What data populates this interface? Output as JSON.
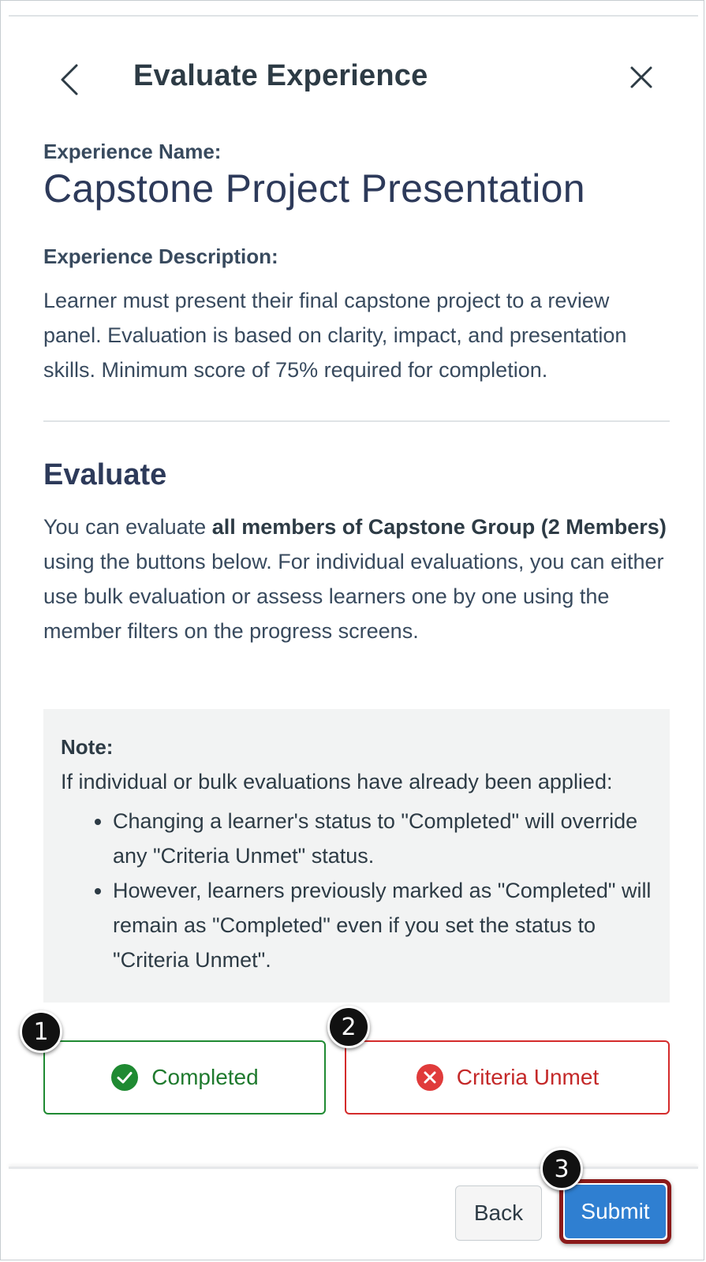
{
  "header": {
    "title": "Evaluate Experience",
    "back_icon": "chevron-left-icon",
    "close_icon": "close-icon"
  },
  "experience": {
    "name_label": "Experience Name:",
    "name": "Capstone Project Presentation",
    "description_label": "Experience Description:",
    "description": "Learner must present their final capstone project to a review panel. Evaluation is based on clarity, impact, and presentation skills. Minimum score of 75% required for completion."
  },
  "evaluate": {
    "title": "Evaluate",
    "text_before": "You can evaluate ",
    "text_bold": "all members of Capstone Group (2 Members)",
    "text_after": " using the buttons below. For individual evaluations, you can either use bulk evaluation or assess learners one by one using the member filters on the progress screens."
  },
  "note": {
    "title": "Note:",
    "intro": "If individual or bulk evaluations have already been applied:",
    "items": [
      "Changing a learner's status to \"Completed\" will override any \"Criteria Unmet\" status.",
      "However, learners previously marked as \"Completed\" will remain as \"Completed\" even if you set the status to \"Criteria Unmet\"."
    ]
  },
  "actions": {
    "completed_label": "Completed",
    "completed_icon": "check-circle-icon",
    "criteria_unmet_label": "Criteria Unmet",
    "criteria_unmet_icon": "x-circle-icon"
  },
  "footer": {
    "back_label": "Back",
    "submit_label": "Submit"
  },
  "callouts": [
    "1",
    "2",
    "3"
  ],
  "colors": {
    "completed": "#1f8a32",
    "criteria_unmet": "#d42b2b",
    "submit": "#2f7fd1",
    "highlight": "#8b1a1a",
    "note_bg": "#f2f3f3"
  }
}
